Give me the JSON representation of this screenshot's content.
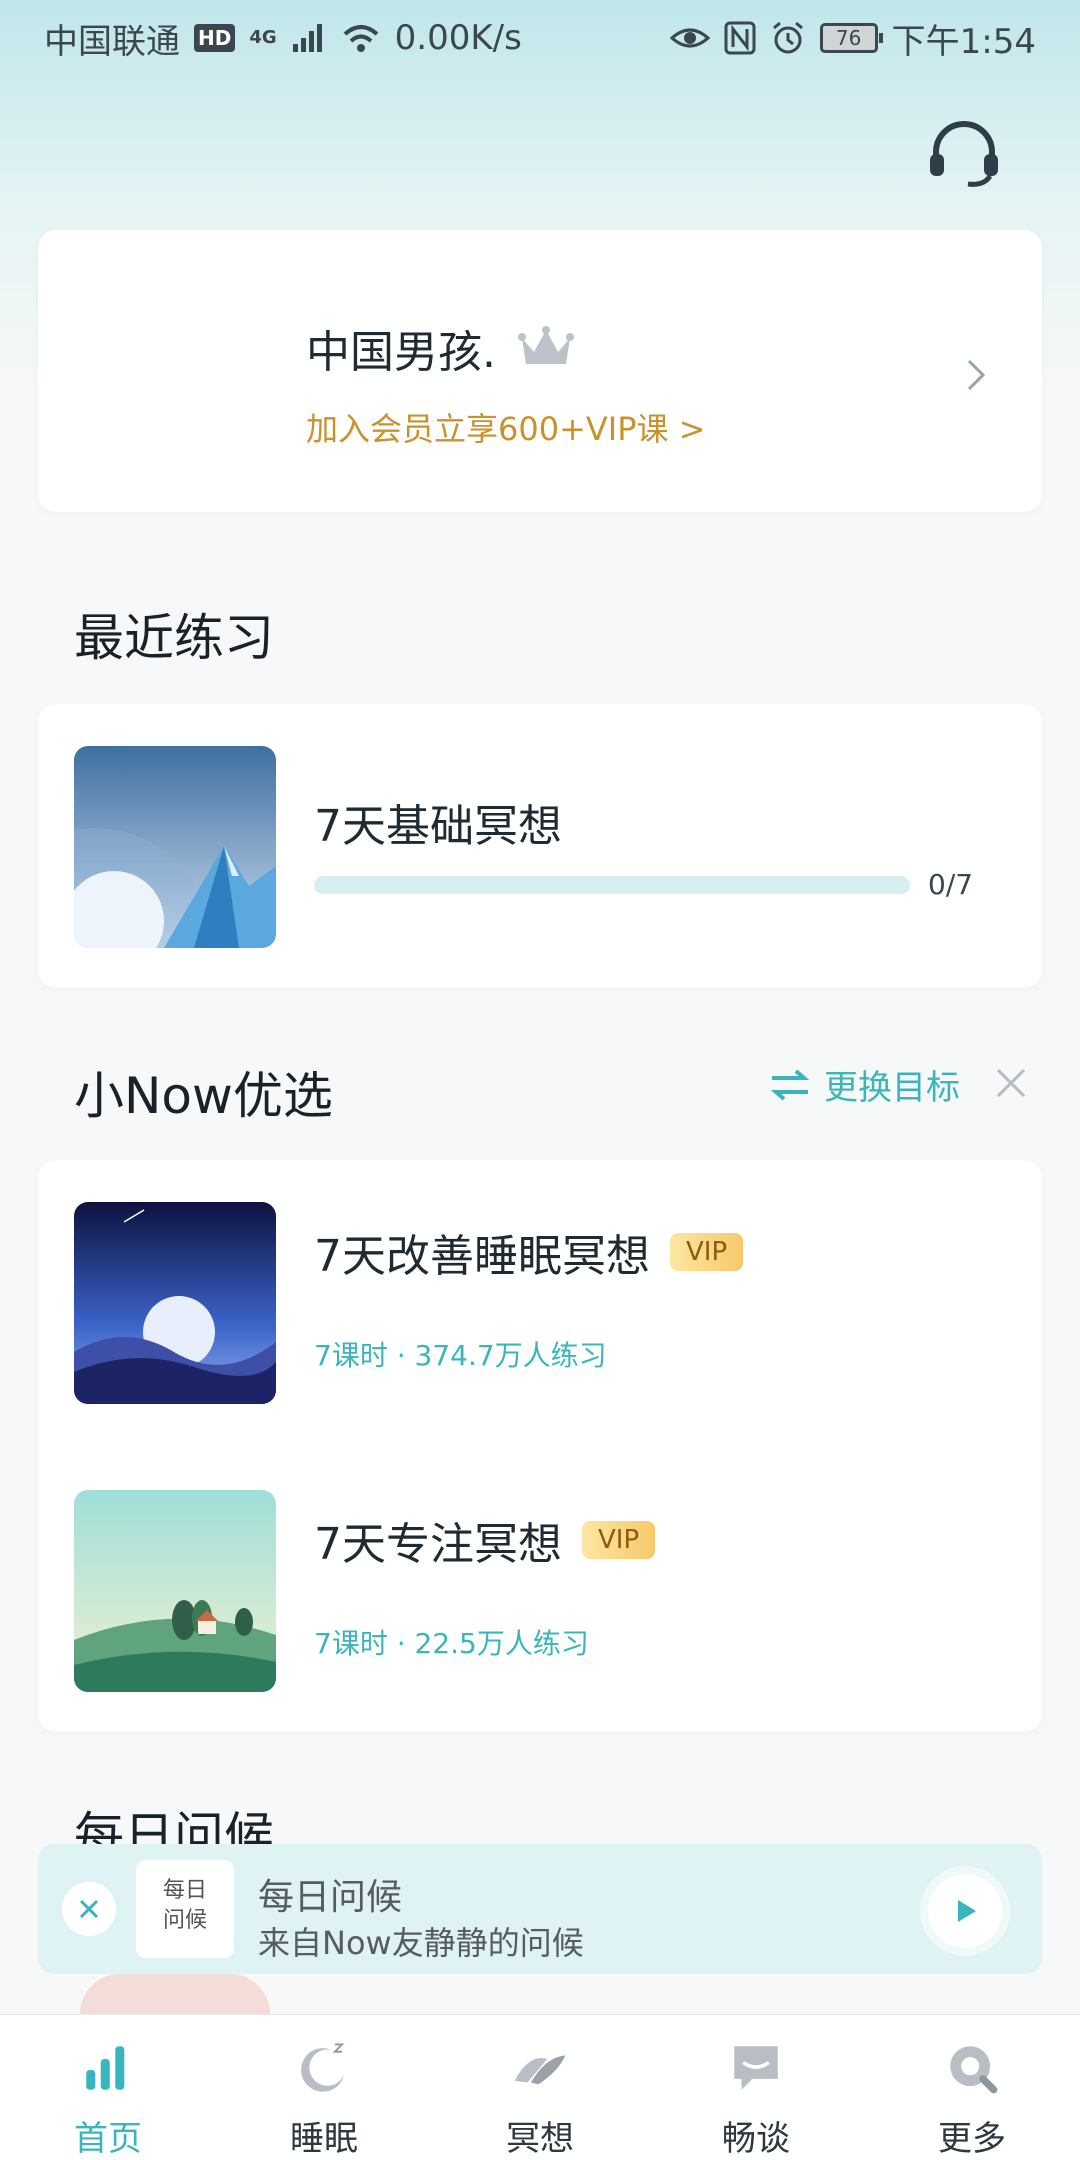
{
  "status_bar": {
    "carrier": "中国联通",
    "hd": "HD",
    "network": "4G",
    "speed": "0.00K/s",
    "battery": "76",
    "time": "下午1:54"
  },
  "profile": {
    "username": "中国男孩.",
    "vip_cta": "加入会员立享600+VIP课 >"
  },
  "recent": {
    "section_title": "最近练习",
    "course_title": "7天基础冥想",
    "progress_text": "0/7",
    "progress_fraction": 0
  },
  "picks": {
    "section_title": "小Now优选",
    "change_goal": "更换目标",
    "items": [
      {
        "title": "7天改善睡眠冥想",
        "tag": "VIP",
        "meta": "7课时 · 374.7万人练习"
      },
      {
        "title": "7天专注冥想",
        "tag": "VIP",
        "meta": "7课时 · 22.5万人练习"
      }
    ]
  },
  "daily": {
    "section_title": "每日问候"
  },
  "mini_player": {
    "thumb_text": "每日\n问候",
    "title": "每日问候",
    "subtitle": "来自Now友静静的问候"
  },
  "tabs": [
    {
      "label": "首页",
      "active": true
    },
    {
      "label": "睡眠",
      "active": false
    },
    {
      "label": "冥想",
      "active": false
    },
    {
      "label": "畅谈",
      "active": false
    },
    {
      "label": "更多",
      "active": false
    }
  ],
  "colors": {
    "accent": "#39b6bd",
    "vip_gold": "#c9922a"
  }
}
